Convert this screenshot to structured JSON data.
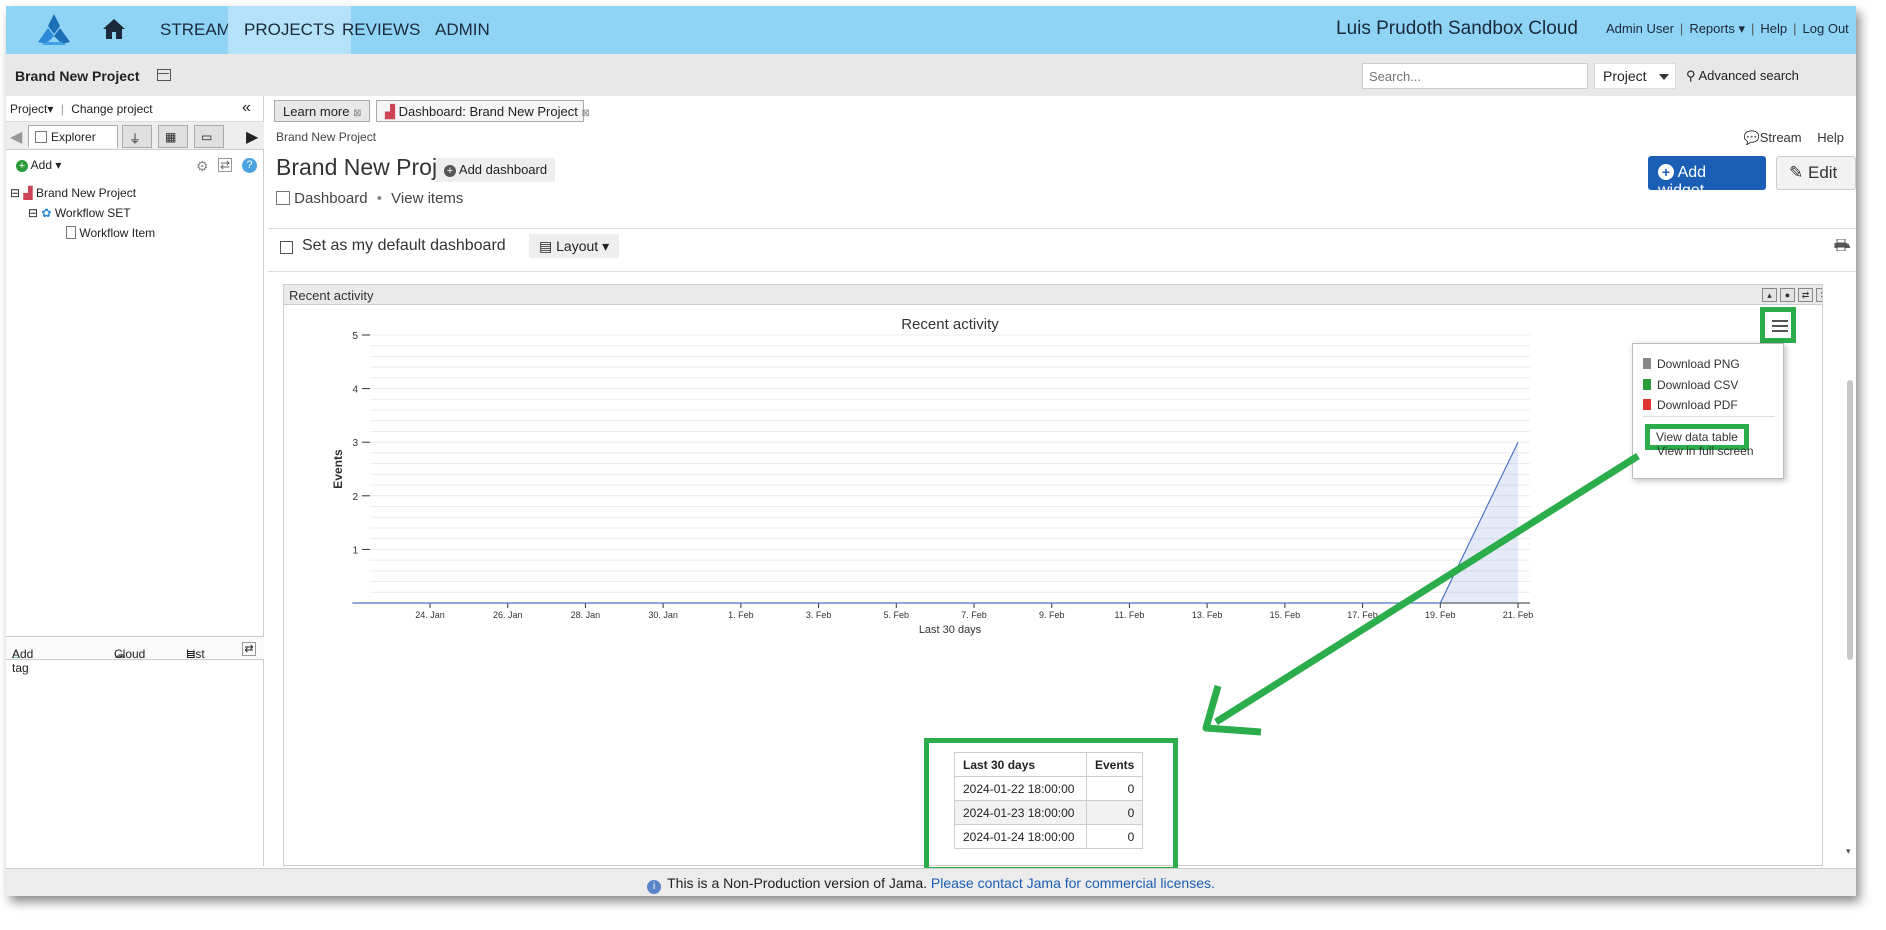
{
  "nav": {
    "tabs": [
      "STREAM",
      "PROJECTS",
      "REVIEWS",
      "ADMIN"
    ],
    "active_tab": "PROJECTS",
    "cloud_name": "Luis Prudoth Sandbox Cloud",
    "links": {
      "user": "Admin User",
      "reports": "Reports",
      "help": "Help",
      "logout": "Log Out"
    }
  },
  "subbar": {
    "project_title": "Brand New Project",
    "search_placeholder": "Search...",
    "scope": "Project",
    "advanced_search": "Advanced search"
  },
  "left_pane": {
    "project_menu": "Project",
    "change_project": "Change project",
    "explorer_tab": "Explorer",
    "add": "Add",
    "tree": [
      {
        "label": "Brand New Project",
        "level": 0
      },
      {
        "label": "Workflow SET",
        "level": 1
      },
      {
        "label": "Workflow Item",
        "level": 2
      }
    ],
    "bottom": {
      "add_tag": "Add tag",
      "cloud": "Cloud",
      "list": "List"
    }
  },
  "content": {
    "tabs": [
      "Learn more",
      "Dashboard: Brand New Project"
    ],
    "breadcrumb": "Brand New Project",
    "stream": "Stream",
    "help": "Help",
    "title": "Brand New Project",
    "add_dashboard": "Add dashboard",
    "dashboard": "Dashboard",
    "dot": "•",
    "view_items": "View items",
    "add_widget": "Add widget",
    "edit": "Edit",
    "default_dashboard": "Set as my default dashboard",
    "layout": "Layout"
  },
  "widget": {
    "header": "Recent activity",
    "menu": [
      "Download PNG",
      "Download CSV",
      "Download PDF",
      "View data table",
      "View in full screen"
    ],
    "table": {
      "headers": [
        "Last 30 days",
        "Events"
      ],
      "rows": [
        [
          "2024-01-22 18:00:00",
          "0"
        ],
        [
          "2024-01-23 18:00:00",
          "0"
        ],
        [
          "2024-01-24 18:00:00",
          "0"
        ]
      ]
    }
  },
  "chart_data": {
    "type": "area",
    "title": "Recent activity",
    "xlabel": "Last 30 days",
    "ylabel": "Events",
    "ylim": [
      0,
      5
    ],
    "yticks": [
      1,
      2,
      3,
      4,
      5
    ],
    "x_ticks": [
      "24. Jan",
      "26. Jan",
      "28. Jan",
      "30. Jan",
      "1. Feb",
      "3. Feb",
      "5. Feb",
      "7. Feb",
      "9. Feb",
      "11. Feb",
      "13. Feb",
      "15. Feb",
      "17. Feb",
      "19. Feb",
      "21. Feb"
    ],
    "series": [
      {
        "values": [
          {
            "x": "2024-01-22",
            "y": 0
          },
          {
            "x": "2024-02-19",
            "y": 0
          },
          {
            "x": "2024-02-21",
            "y": 3
          }
        ]
      }
    ],
    "grid": true,
    "legend": "none"
  },
  "status": {
    "text": "This is a Non-Production version of Jama.",
    "link": "Please contact Jama for commercial licenses."
  },
  "colors": {
    "nav_bg": "#8fd3f5",
    "accent": "#1b5eb5",
    "highlight": "#2aad4a",
    "series": "#4a74c8"
  }
}
